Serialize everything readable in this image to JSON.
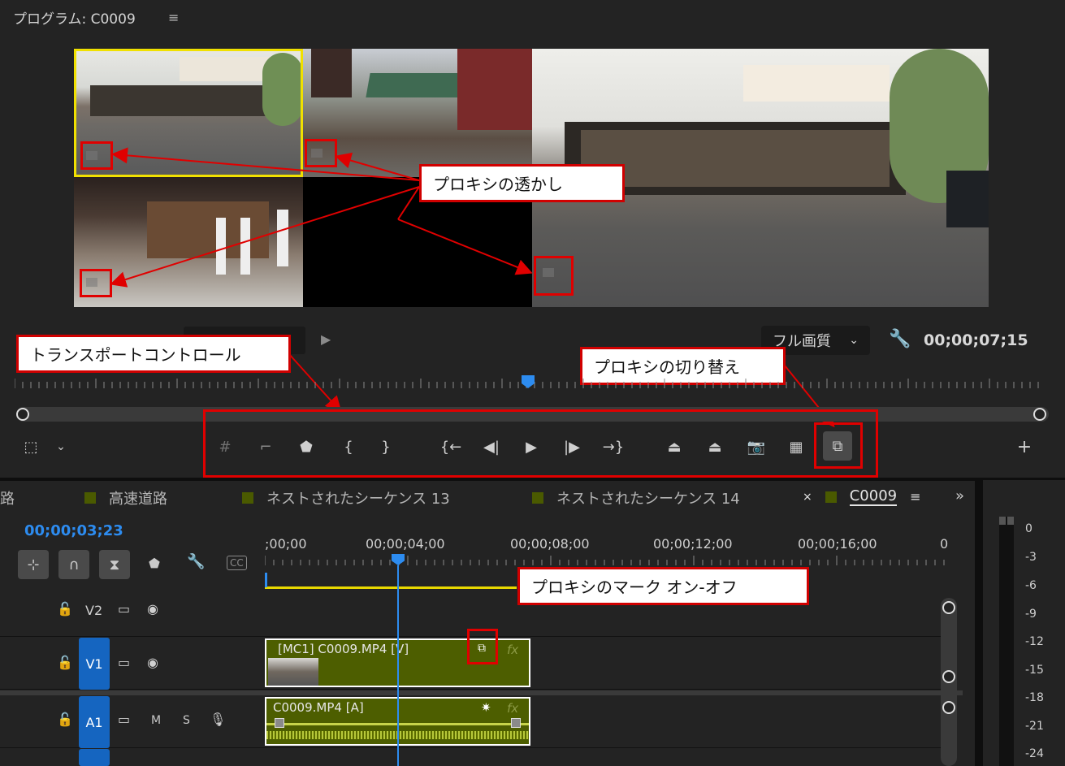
{
  "program": {
    "title": "プログラム: C0009",
    "timecode": "00;00;07;15",
    "quality": "フル画質"
  },
  "callouts": {
    "watermark": "プロキシの透かし",
    "transport": "トランスポートコントロール",
    "toggle": "プロキシの切り替え",
    "mark": "プロキシのマーク オン-オフ"
  },
  "timeline": {
    "tabs": [
      {
        "label": "路"
      },
      {
        "label": "高速道路"
      },
      {
        "label": "ネストされたシーケンス 13"
      },
      {
        "label": "ネストされたシーケンス 14"
      },
      {
        "label": "C0009"
      }
    ],
    "timecode": "00;00;03;23",
    "ruler": [
      ";00;00",
      "00;00;04;00",
      "00;00;08;00",
      "00;00;12;00",
      "00;00;16;00",
      "0"
    ],
    "tracks": {
      "v2": "V2",
      "v1": "V1",
      "a1": "A1",
      "m": "M",
      "s": "S"
    },
    "clips": {
      "video": "[MC1] C0009.MP4 [V]",
      "audio": "C0009.MP4 [A]",
      "fx": "fx"
    }
  },
  "meter": {
    "labels": [
      "0",
      "-3",
      "-6",
      "-9",
      "-12",
      "-15",
      "-18",
      "-21",
      "-24"
    ]
  },
  "colors": {
    "accent_blue": "#2d8cf0",
    "track_blue": "#1565c0",
    "clip_green": "#4d5e00",
    "callout_red": "#d00000",
    "selection_yellow": "#f0e000"
  }
}
